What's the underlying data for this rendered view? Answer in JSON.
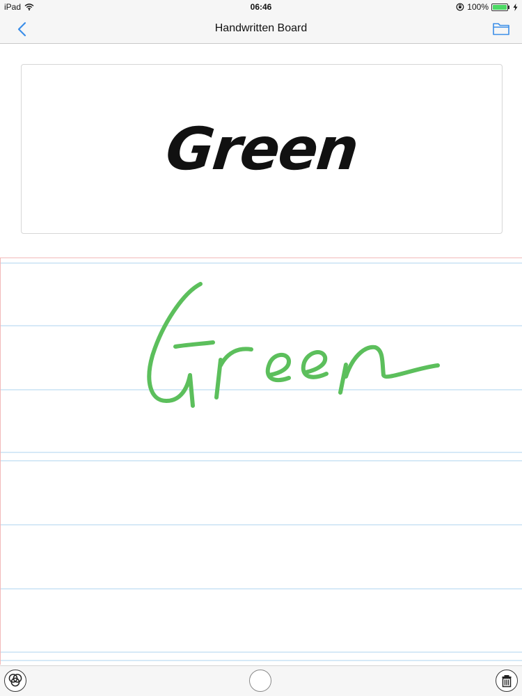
{
  "status_bar": {
    "carrier": "iPad",
    "time": "06:46",
    "battery_text": "100%",
    "battery_level": 1.0,
    "battery_color": "#4cd964"
  },
  "nav": {
    "title": "Handwritten Board",
    "back_icon": "chevron-left-icon",
    "folder_icon": "folder-icon",
    "accent_color": "#3b8ee8"
  },
  "sample": {
    "word": "Green"
  },
  "board": {
    "ink_color": "#5cbf5c",
    "guide_color": "#d6e9f7",
    "margin_color": "#f2b9b9"
  },
  "toolbar": {
    "color_picker_icon": "color-circles-icon",
    "pen_icon": "pen-size-circle-icon",
    "trash_icon": "trash-icon"
  }
}
